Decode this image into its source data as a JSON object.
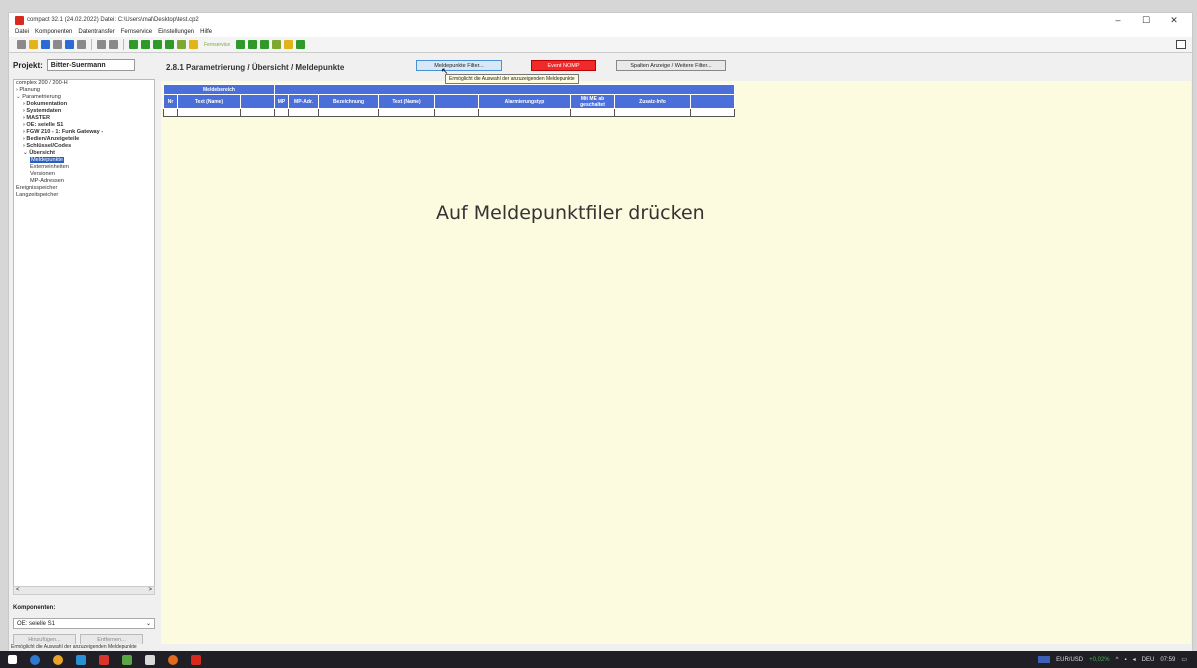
{
  "window": {
    "title": "compact 32.1  (24.02.2022)  Datei: C:\\Users\\mal\\Desktop\\test.cp2",
    "controls": [
      "–",
      "☐",
      "✕"
    ]
  },
  "menu": [
    "Datei",
    "Komponenten",
    "Datentransfer",
    "Fernservice",
    "Einstellungen",
    "Hilfe"
  ],
  "toolbar": {
    "text_button": "Fernservice"
  },
  "left": {
    "project_label": "Projekt:",
    "project_name": "Bitter-Suermann",
    "tree": [
      {
        "text": "complex 200 / 200-H",
        "indent": 0,
        "bold": false
      },
      {
        "text": "Planung",
        "indent": 0,
        "bold": false,
        "prefix": "›"
      },
      {
        "text": "Parametrierung",
        "indent": 0,
        "bold": false,
        "prefix": "⌄"
      },
      {
        "text": "Dokumentation",
        "indent": 1,
        "bold": true,
        "prefix": "›"
      },
      {
        "text": "Systemdaten",
        "indent": 1,
        "bold": true,
        "prefix": "›"
      },
      {
        "text": "MASTER",
        "indent": 1,
        "bold": true,
        "prefix": "›"
      },
      {
        "text": "OE: seielle S1",
        "indent": 1,
        "bold": true,
        "prefix": "›"
      },
      {
        "text": "FGW 210 - 1: Funk Gateway -",
        "indent": 1,
        "bold": true,
        "prefix": "›"
      },
      {
        "text": "Bedien/Anzeigeteile",
        "indent": 1,
        "bold": true,
        "prefix": "›"
      },
      {
        "text": "Schlüssel/Codes",
        "indent": 1,
        "bold": true,
        "prefix": "›"
      },
      {
        "text": "Übersicht",
        "indent": 1,
        "bold": true,
        "prefix": "⌄"
      },
      {
        "text": "Meldepunkte",
        "indent": 2,
        "bold": false,
        "selected": true
      },
      {
        "text": "Externeinheiten",
        "indent": 2,
        "bold": false
      },
      {
        "text": "Versionen",
        "indent": 2,
        "bold": false
      },
      {
        "text": "MP-Adressen",
        "indent": 2,
        "bold": false
      },
      {
        "text": "Ereignisspeicher",
        "indent": 0,
        "bold": false
      },
      {
        "text": "Langzeitspeicher",
        "indent": 0,
        "bold": false
      }
    ],
    "scroll_left": "<",
    "scroll_right": ">",
    "komponenten_label": "Komponenten:",
    "komponenten_value": "OE: seielle S1",
    "add_button": "Hinzufügen...",
    "remove_button": "Entfernen..."
  },
  "main": {
    "page_title": "2.8.1  Parametrierung / Übersicht / Meldepunkte",
    "filter_button": "Meldepunkte Filter...",
    "red_button": "Event NOMP",
    "columns_button": "Spalten Anzeige / Weitere Filter...",
    "tooltip": "Ermöglicht die Auswahl der anzuzeigenden Meldepunkte",
    "table": {
      "group_header": "Meldebereich",
      "headers": [
        "Nr",
        "Text (Name)",
        "",
        "MP",
        "MP-Adr.",
        "Bezeichnung",
        "Text (Name)",
        "",
        "Alarmierungstyp",
        "Mit ME ab geschaltet",
        "Zusatz-Info",
        ""
      ]
    },
    "overlay_text": "Auf Meldepunktfiler drücken"
  },
  "statusbar": "Ermöglicht die Auswahl der anzuzeigenden Meldepunkte",
  "taskbar": {
    "tray_currency": "EUR/USD",
    "tray_change": "+0,02%",
    "tray_lang": "DEU",
    "tray_time": "07:59"
  }
}
